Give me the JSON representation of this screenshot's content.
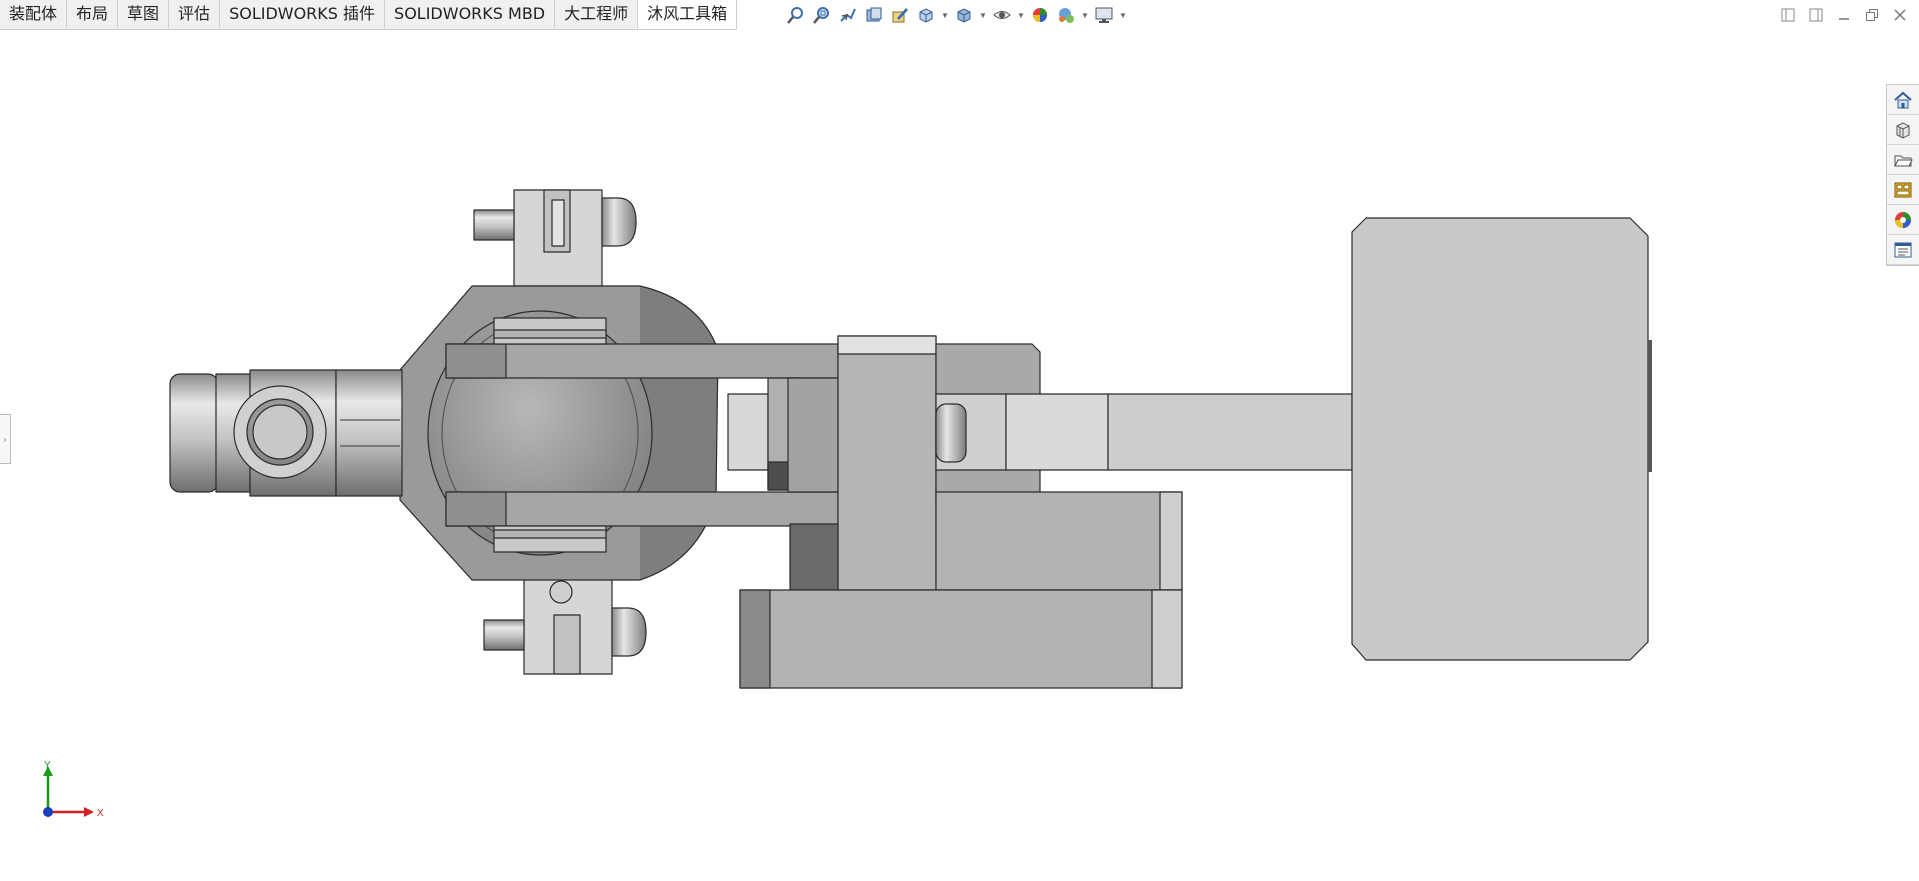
{
  "tabs": [
    {
      "label": "装配体",
      "active": false
    },
    {
      "label": "布局",
      "active": false
    },
    {
      "label": "草图",
      "active": false
    },
    {
      "label": "评估",
      "active": false
    },
    {
      "label": "SOLIDWORKS 插件",
      "active": false
    },
    {
      "label": "SOLIDWORKS MBD",
      "active": false
    },
    {
      "label": "大工程师",
      "active": false
    },
    {
      "label": "沐风工具箱",
      "active": true
    }
  ],
  "headsup_icons": [
    "zoom-to-fit-icon",
    "zoom-to-area-icon",
    "previous-view-icon",
    "section-view-icon",
    "dynamic-annotation-icon",
    "view-orientation-icon",
    "display-style-icon",
    "hide-show-items-icon",
    "edit-appearance-icon",
    "apply-scene-icon",
    "view-settings-icon"
  ],
  "taskpane_icons": [
    "home-icon",
    "design-library-icon",
    "file-explorer-icon",
    "view-palette-icon",
    "appearances-icon",
    "custom-properties-icon"
  ],
  "triad": {
    "y_label": "Y",
    "x_label": "X"
  },
  "colors": {
    "part_light": "#cfcfcf",
    "part_mid": "#b0b0b0",
    "part_dark": "#7a7a7a",
    "edge": "#2b2b2b",
    "triad_y": "#1a9a1a",
    "triad_x": "#d42020",
    "triad_origin": "#1a3fbf"
  }
}
